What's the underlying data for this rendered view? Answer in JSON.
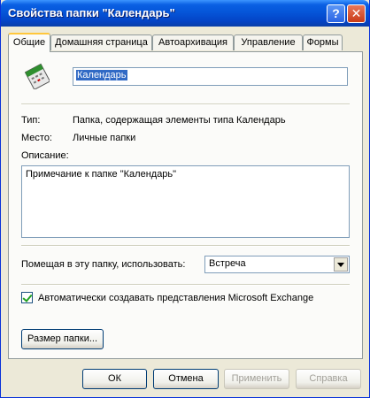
{
  "window": {
    "title": "Свойства папки \"Календарь\""
  },
  "titlebar": {
    "help": "?",
    "close": "✕"
  },
  "tabs": [
    {
      "label": "Общие",
      "active": true
    },
    {
      "label": "Домашняя страница"
    },
    {
      "label": "Автоархивация"
    },
    {
      "label": "Управление"
    },
    {
      "label": "Формы"
    }
  ],
  "general": {
    "icon": "calendar-folder-icon",
    "name_value": "Календарь",
    "type_label": "Тип:",
    "type_value": "Папка, содержащая элементы типа Календарь",
    "location_label": "Место:",
    "location_value": "Личные папки",
    "description_label": "Описание:",
    "description_value": "Примечание к папке \"Календарь\"",
    "post_label": "Помещая в эту папку, использовать:",
    "post_value": "Встреча",
    "exchange_checkbox_label": "Автоматически создавать представления Microsoft Exchange",
    "exchange_checked": true,
    "folder_size_button": "Размер папки..."
  },
  "buttons": {
    "ok": "ОК",
    "cancel": "Отмена",
    "apply": "Применить",
    "help": "Справка"
  }
}
